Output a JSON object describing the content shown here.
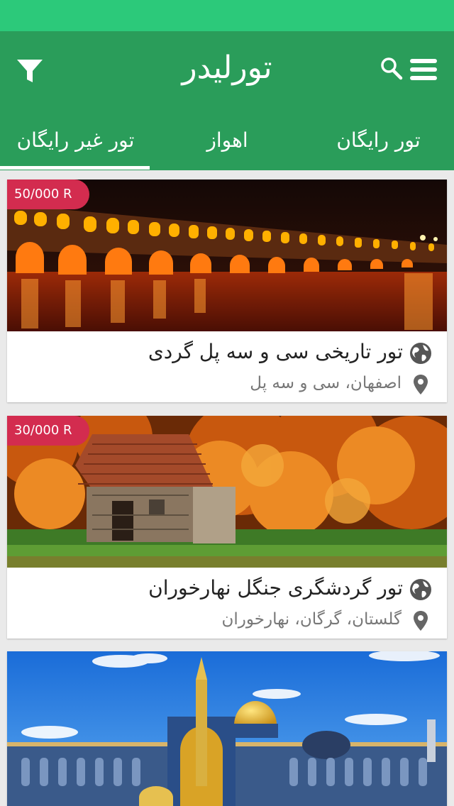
{
  "app": {
    "title": "تورلیدر"
  },
  "tabs": [
    {
      "label": "تور رایگان"
    },
    {
      "label": "اهواز"
    },
    {
      "label": "تور غیر رایگان"
    }
  ],
  "colors": {
    "status_bar": "#2cc97a",
    "app_bar": "#2a9d5a",
    "price_badge": "#d32c4f"
  },
  "cards": [
    {
      "price": "50/000 R",
      "title": "تور تاریخی سی و سه پل گردی",
      "location": "اصفهان، سی و سه پل"
    },
    {
      "price": "30/000 R",
      "title": "تور گردشگری جنگل نهارخوران",
      "location": "گلستان، گرگان، نهارخوران"
    }
  ]
}
